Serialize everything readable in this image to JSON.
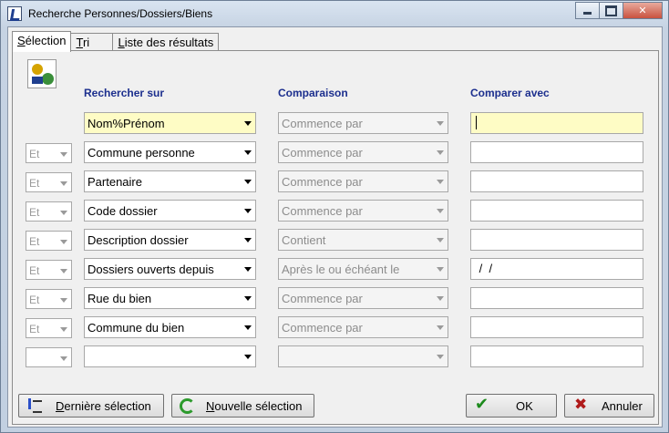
{
  "window": {
    "title": "Recherche Personnes/Dossiers/Biens"
  },
  "tabs": [
    {
      "prefix": "",
      "underline": "S",
      "rest": "élection"
    },
    {
      "prefix": "",
      "underline": "T",
      "rest": "ri"
    },
    {
      "prefix": "",
      "underline": "L",
      "rest": "iste des résultats"
    }
  ],
  "headers": {
    "search_on": "Rechercher sur",
    "comparison": "Comparaison",
    "compare_with": "Comparer avec"
  },
  "rows": [
    {
      "logic": "",
      "field": "Nom%Prénom",
      "comparison": "Commence par",
      "value": ""
    },
    {
      "logic": "Et",
      "field": "Commune personne",
      "comparison": "Commence par",
      "value": ""
    },
    {
      "logic": "Et",
      "field": "Partenaire",
      "comparison": "Commence par",
      "value": ""
    },
    {
      "logic": "Et",
      "field": "Code dossier",
      "comparison": "Commence par",
      "value": ""
    },
    {
      "logic": "Et",
      "field": "Description dossier",
      "comparison": "Contient",
      "value": ""
    },
    {
      "logic": "Et",
      "field": "Dossiers ouverts depuis",
      "comparison": "Après le ou échéant le",
      "value": " /  /"
    },
    {
      "logic": "Et",
      "field": "Rue du bien",
      "comparison": "Commence par",
      "value": ""
    },
    {
      "logic": "Et",
      "field": "Commune du bien",
      "comparison": "Commence par",
      "value": ""
    },
    {
      "logic": "",
      "field": "",
      "comparison": "",
      "value": ""
    }
  ],
  "buttons": {
    "last_selection": {
      "underline": "D",
      "rest": "ernière sélection"
    },
    "new_selection": {
      "underline": "N",
      "rest": "ouvelle sélection"
    },
    "ok": "OK",
    "cancel": "Annuler"
  }
}
